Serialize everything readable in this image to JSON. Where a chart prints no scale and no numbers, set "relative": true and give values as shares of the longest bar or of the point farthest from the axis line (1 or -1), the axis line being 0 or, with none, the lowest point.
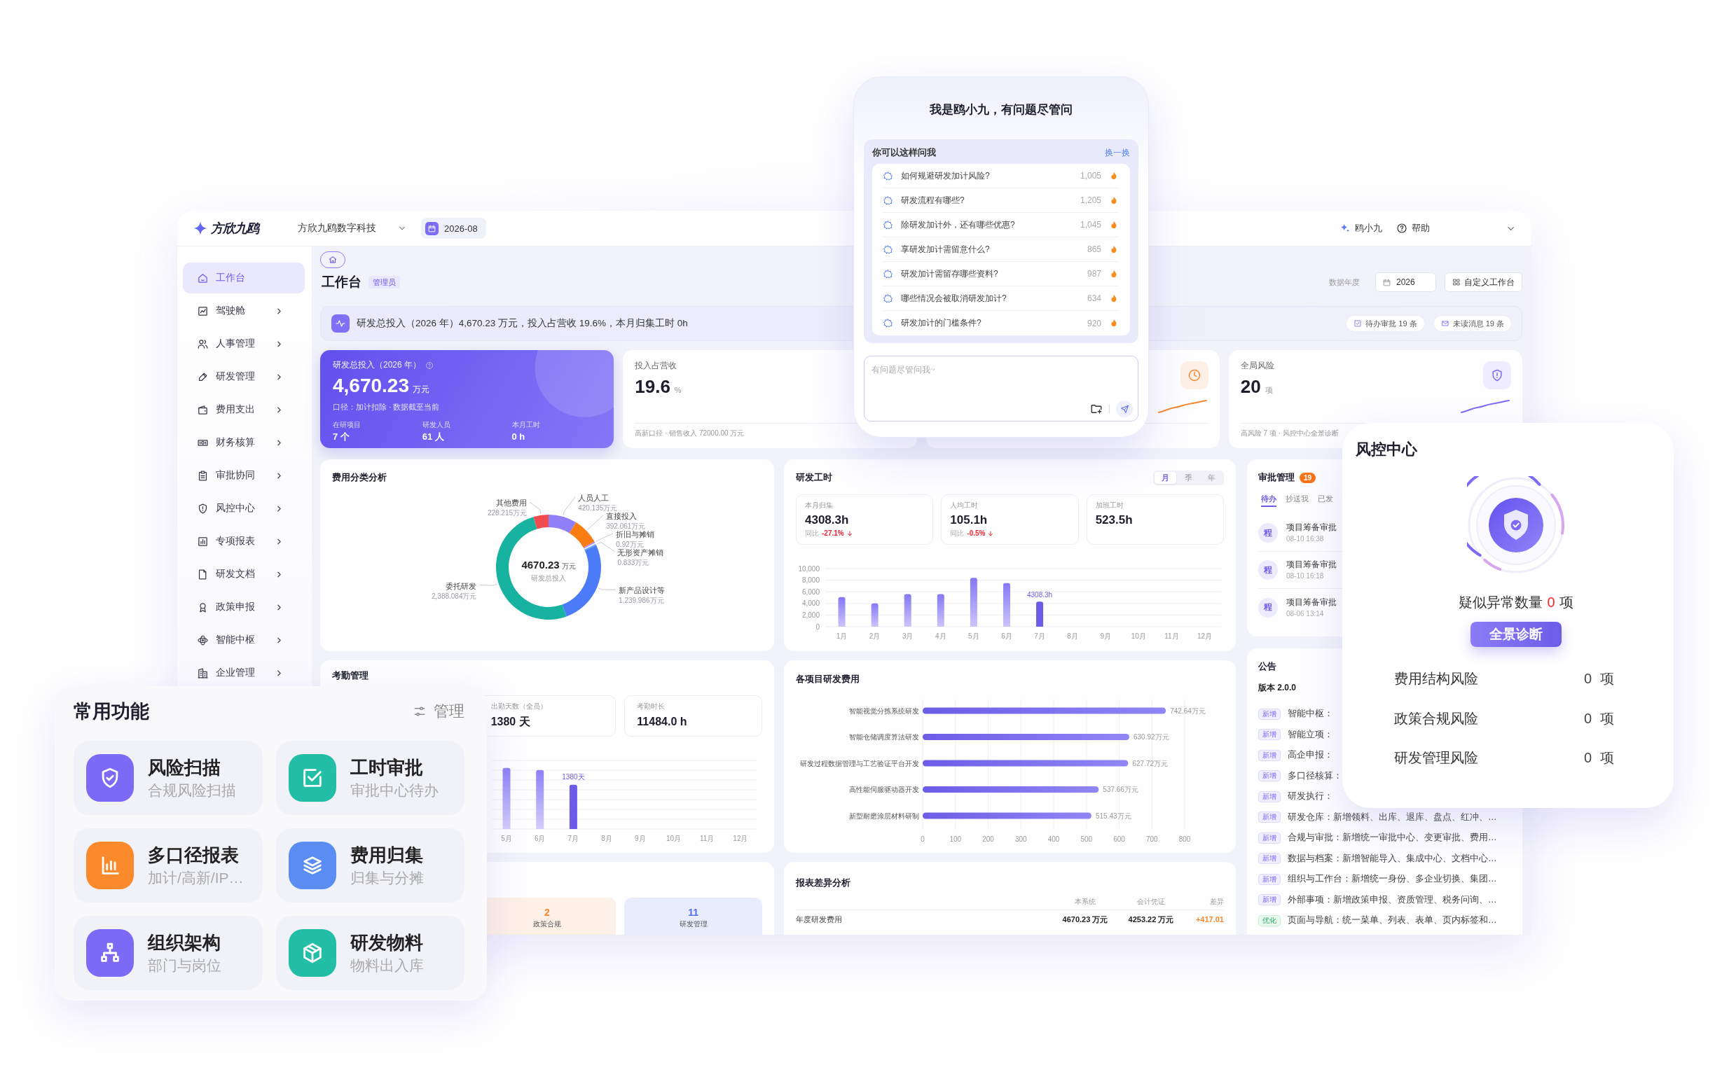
{
  "topbar": {
    "logo_text": "方欣九鸥",
    "company": "方欣九鸥数字科技",
    "month": "2026-08",
    "assistant": "鸥小九",
    "help": "帮助"
  },
  "sidebar": {
    "items": [
      {
        "label": "工作台",
        "selected": true,
        "expandable": false
      },
      {
        "label": "驾驶舱",
        "selected": false,
        "expandable": true
      },
      {
        "label": "人事管理",
        "selected": false,
        "expandable": true
      },
      {
        "label": "研发管理",
        "selected": false,
        "expandable": true
      },
      {
        "label": "费用支出",
        "selected": false,
        "expandable": true
      },
      {
        "label": "财务核算",
        "selected": false,
        "expandable": true
      },
      {
        "label": "审批协同",
        "selected": false,
        "expandable": true
      },
      {
        "label": "风控中心",
        "selected": false,
        "expandable": true
      },
      {
        "label": "专项报表",
        "selected": false,
        "expandable": true
      },
      {
        "label": "研发文档",
        "selected": false,
        "expandable": true
      },
      {
        "label": "政策申报",
        "selected": false,
        "expandable": true
      },
      {
        "label": "智能中枢",
        "selected": false,
        "expandable": true
      },
      {
        "label": "企业管理",
        "selected": false,
        "expandable": true
      }
    ]
  },
  "page_header": {
    "title": "工作台",
    "role_badge": "管理员",
    "year_label": "数据年度",
    "year": "2026",
    "customize_button": "自定义工作台"
  },
  "summary_banner": {
    "text": "研发总投入（2026 年）4,670.23 万元，投入占营收 19.6%，本月归集工时 0h",
    "chips": [
      {
        "label": "待办审批 19 条",
        "kind": "approval"
      },
      {
        "label": "未读消息 19 条",
        "kind": "message"
      }
    ]
  },
  "kpi_cards": [
    {
      "kind": "hero",
      "title": "研发总投入（2026 年）",
      "value": "4,670.23",
      "unit": "万元",
      "note": "口径：加计扣除 · 数据截至当前",
      "stats": [
        {
          "label": "在研项目",
          "value": "7 个"
        },
        {
          "label": "研发人员",
          "value": "61 人"
        },
        {
          "label": "本月工时",
          "value": "0 h"
        }
      ]
    },
    {
      "kind": "metric",
      "title": "投入占营收",
      "value": "19.6",
      "unit": "%",
      "footer": "高新口径 · 销售收入 72000.00 万元"
    },
    {
      "kind": "metric",
      "color": "#f7882f"
    },
    {
      "kind": "metric",
      "title": "全局风险",
      "value": "20",
      "unit": "项",
      "footer": "高风险 7 项 · 风控中心全景诊断",
      "color": "#7b6cf5"
    }
  ],
  "expense_breakdown": {
    "title": "费用分类分析",
    "center_value": "4670.23",
    "center_unit": "万元",
    "center_label": "研发总投入",
    "chart_data": {
      "type": "donut",
      "categories": [
        "人员人工",
        "直接投入",
        "折旧与摊销",
        "无形资产摊销",
        "新产品设计等",
        "委托研发",
        "其他费用"
      ],
      "values": [
        420.135,
        392.061,
        0.92,
        0.833,
        1239.986,
        2388.084,
        228.215
      ],
      "value_labels": [
        "420.135万元",
        "392.061万元",
        "0.92万元",
        "0.833万元",
        "1,239.986万元",
        "2,388.084万元",
        "228.215万元"
      ],
      "colors": [
        "#8f80f7",
        "#f97d12",
        "#a78bfa",
        "#60a5fa",
        "#4b7bf6",
        "#17b3a0",
        "#f04b4f"
      ]
    }
  },
  "work_hours": {
    "title": "研发工时",
    "periods": [
      {
        "label": "月",
        "selected": true
      },
      {
        "label": "季",
        "selected": false
      },
      {
        "label": "年",
        "selected": false
      }
    ],
    "stats": [
      {
        "label": "本月归集",
        "value": "4308.3h",
        "compare_label": "同比",
        "change": "-27.1%",
        "falling": true
      },
      {
        "label": "人均工时",
        "value": "105.1h",
        "compare_label": "同比",
        "change": "-0.5%",
        "falling": true
      },
      {
        "label": "加班工时",
        "value": "523.5h"
      }
    ],
    "chart_data": {
      "type": "bar",
      "categories": [
        "1月",
        "2月",
        "3月",
        "4月",
        "5月",
        "6月",
        "7月",
        "8月",
        "9月",
        "10月",
        "11月",
        "12月"
      ],
      "values": [
        5100,
        4000,
        5600,
        5600,
        8400,
        7500,
        4308.3,
        null,
        null,
        null,
        null,
        null
      ],
      "ylim": [
        0,
        10000
      ],
      "yticks": [
        {
          "value": 0,
          "label": "0"
        },
        {
          "value": 2000,
          "label": "2,000"
        },
        {
          "value": 4000,
          "label": "4,000"
        },
        {
          "value": 6000,
          "label": "6,000"
        },
        {
          "value": 8000,
          "label": "8,000"
        },
        {
          "value": 10000,
          "label": "10,000"
        }
      ],
      "grid": true,
      "annotations": [
        "4308.3h"
      ]
    }
  },
  "approvals": {
    "title": "审批管理",
    "count": "19",
    "tabs": [
      {
        "label": "待办",
        "selected": true
      },
      {
        "label": "抄送我",
        "selected": false
      },
      {
        "label": "已发",
        "selected": false
      }
    ],
    "items": [
      {
        "avatar": "程",
        "title": "项目筹备审批",
        "time": "08-10 16:38"
      },
      {
        "avatar": "程",
        "title": "项目筹备审批",
        "time": "08-10 16:18"
      },
      {
        "avatar": "程",
        "title": "项目筹备审批",
        "time": "08-06 13:14"
      }
    ]
  },
  "attendance": {
    "title": "考勤管理",
    "stats": [
      {
        "label": "出勤天数（全员）",
        "value": "1380 天"
      },
      {
        "label": "考勤时长",
        "value": "11484.0 h"
      }
    ],
    "chart_data": {
      "type": "bar",
      "relative": true,
      "categories": [
        "5月",
        "6月",
        "7月",
        "8月",
        "9月",
        "10月",
        "11月",
        "12月"
      ],
      "values": [
        1,
        0.965,
        0.724,
        null,
        null,
        null,
        null,
        null
      ],
      "grid": true,
      "annotations": [
        "1380天"
      ]
    }
  },
  "project_costs": {
    "title": "各项目研发费用",
    "chart_data": {
      "type": "bar",
      "orientation": "horizontal",
      "categories": [
        "智能视觉分拣系统研发",
        "智能仓储调度算法研发",
        "研发过程数据管理与工艺验证平台开发",
        "高性能伺服驱动器开发",
        "新型耐磨涂层材料研制"
      ],
      "values": [
        742.64,
        630.92,
        627.72,
        537.66,
        515.43
      ],
      "value_labels": [
        "742.64万元",
        "630.92万元",
        "627.72万元",
        "537.66万元",
        "515.43万元"
      ],
      "xlim": [
        0,
        800
      ],
      "xticks": [
        0,
        100,
        200,
        300,
        400,
        500,
        600,
        700,
        800
      ],
      "grid": true
    }
  },
  "notices": {
    "title": "公告",
    "version": "版本 2.0.0",
    "items": [
      {
        "tag": "新增",
        "kind": "new",
        "text": "智能中枢："
      },
      {
        "tag": "新增",
        "kind": "new",
        "text": "智能立项："
      },
      {
        "tag": "新增",
        "kind": "new",
        "text": "高企申报："
      },
      {
        "tag": "新增",
        "kind": "new",
        "text": "多口径核算："
      },
      {
        "tag": "新增",
        "kind": "new",
        "text": "研发执行："
      },
      {
        "tag": "新增",
        "kind": "new",
        "text": "研发仓库：新增领料、出库、退库、盘点、红冲、…"
      },
      {
        "tag": "新增",
        "kind": "new",
        "text": "合规与审批：新增统一审批中心、变更审批、费用…"
      },
      {
        "tag": "新增",
        "kind": "new",
        "text": "数据与档案：新增智能导入、集成中心、文档中心…"
      },
      {
        "tag": "新增",
        "kind": "new",
        "text": "组织与工作台：新增统一身份、多企业切换、集团…"
      },
      {
        "tag": "新增",
        "kind": "new",
        "text": "外部事项：新增政策申报、资质管理、税务问询、…"
      },
      {
        "tag": "优化",
        "kind": "improve",
        "text": "页面与导航：统一菜单、列表、表单、页内标签和…"
      }
    ]
  },
  "category_counts": [
    {
      "value": "2",
      "label": "政策合规",
      "color": "#f7882f"
    },
    {
      "value": "11",
      "label": "研发管理",
      "color": "#4f6ff0"
    }
  ],
  "report_diff": {
    "title": "报表差异分析",
    "row_label": "年度研发费用",
    "figures": [
      {
        "heading": "本系统",
        "value": "4670.23 万元"
      },
      {
        "heading": "会计凭证",
        "value": "4253.22 万元"
      },
      {
        "heading": "差异",
        "value": "+417.01"
      }
    ]
  },
  "assistant_popup": {
    "title": "我是鸥小九，有问题尽管问",
    "suggest_title": "你可以这样问我",
    "refresh_link": "换一换",
    "questions": [
      {
        "text": "如何规避研发加计风险?",
        "count": "1,005"
      },
      {
        "text": "研发流程有哪些?",
        "count": "1,205"
      },
      {
        "text": "除研发加计外，还有哪些优惠?",
        "count": "1,045"
      },
      {
        "text": "享研发加计需留意什么?",
        "count": "865"
      },
      {
        "text": "研发加计需留存哪些资料?",
        "count": "987"
      },
      {
        "text": "哪些情况会被取消研发加计?",
        "count": "634"
      },
      {
        "text": "研发加计的门槛条件?",
        "count": "920"
      }
    ],
    "input": {
      "placeholder": "有问题尽管问我~"
    }
  },
  "risk_popup": {
    "title": "风控中心",
    "anomaly": {
      "label": "疑似异常数量",
      "count": "0",
      "unit": "项"
    },
    "button": "全景诊断",
    "rows": [
      {
        "label": "费用结构风险",
        "count": "0",
        "unit": "项"
      },
      {
        "label": "政策合规风险",
        "count": "0",
        "unit": "项"
      },
      {
        "label": "研发管理风险",
        "count": "0",
        "unit": "项"
      }
    ]
  },
  "quick_functions": {
    "title": "常用功能",
    "manage_button": "管理",
    "items": [
      {
        "title": "风险扫描",
        "subtitle": "合规风险扫描",
        "color": "#7a6af6"
      },
      {
        "title": "工时审批",
        "subtitle": "审批中心待办",
        "color": "#22bfa6"
      },
      {
        "title": "多口径报表",
        "subtitle": "加计/高新/IP…",
        "color": "#fb8a2c"
      },
      {
        "title": "费用归集",
        "subtitle": "归集与分摊",
        "color": "#5b8cf3"
      },
      {
        "title": "组织架构",
        "subtitle": "部门与岗位",
        "color": "#7a6af6"
      },
      {
        "title": "研发物料",
        "subtitle": "物料出入库",
        "color": "#22bfa6"
      }
    ]
  }
}
